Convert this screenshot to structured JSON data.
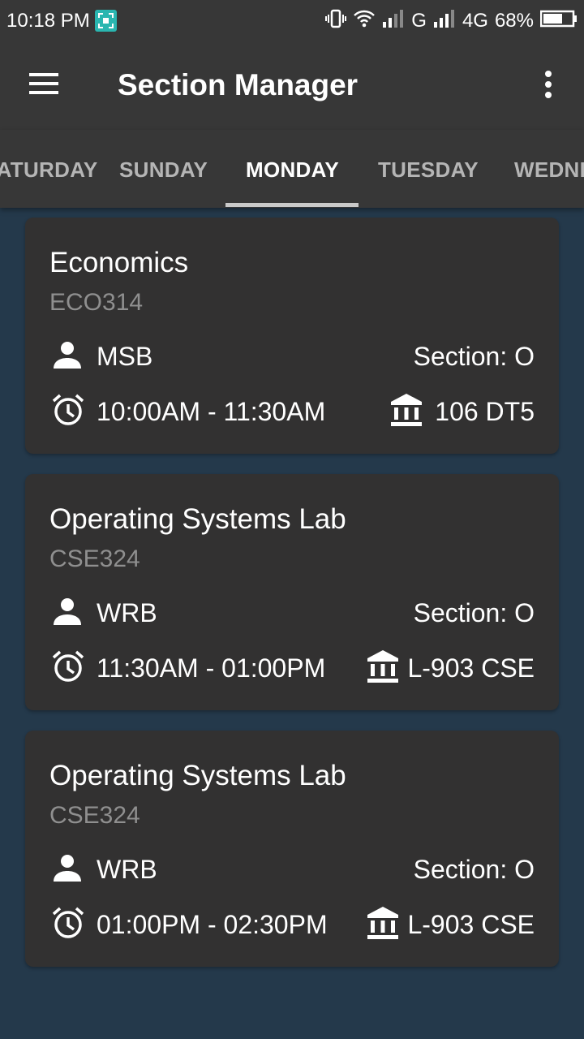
{
  "status_bar": {
    "time": "10:18 PM",
    "network_1": "G",
    "network_2": "4G",
    "battery": "68%"
  },
  "app_bar": {
    "title": "Section Manager",
    "menu_icon": "hamburger-menu-icon",
    "overflow_icon": "more-vert-icon"
  },
  "tabs": [
    {
      "label": "SATURDAY"
    },
    {
      "label": "SUNDAY"
    },
    {
      "label": "MONDAY",
      "selected": true
    },
    {
      "label": "TUESDAY"
    },
    {
      "label": "WEDNESDAY"
    }
  ],
  "classes": [
    {
      "name": "Economics",
      "code": "ECO314",
      "faculty": "MSB",
      "section": "Section: O",
      "time": "10:00AM - 11:30AM",
      "room": "106 DT5"
    },
    {
      "name": "Operating Systems Lab",
      "code": "CSE324",
      "faculty": "WRB",
      "section": "Section: O",
      "time": "11:30AM - 01:00PM",
      "room": "L-903 CSE"
    },
    {
      "name": "Operating Systems Lab",
      "code": "CSE324",
      "faculty": "WRB",
      "section": "Section: O",
      "time": "01:00PM - 02:30PM",
      "room": "L-903 CSE"
    }
  ],
  "colors": {
    "app_bar": "#373737",
    "background": "#24394b",
    "card": "#323131",
    "code_text": "#8f8f8f",
    "tab_inactive": "#b5b5b5"
  }
}
